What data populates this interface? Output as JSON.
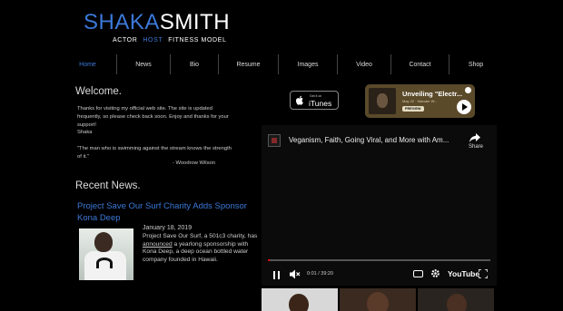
{
  "header": {
    "name_first": "SHAKA",
    "name_last": "SMITH",
    "tag1": "ACTOR",
    "tag2": "HOST",
    "tag3": "FITNESS MODEL"
  },
  "nav": {
    "items": [
      "Home",
      "News",
      "Bio",
      "Resume",
      "Images",
      "Video",
      "Contact",
      "Shop"
    ]
  },
  "welcome": {
    "title": "Welcome.",
    "body1": "Thanks for visiting my official web site. The site is updated frequently, so please check back soon. Enjoy and thanks for your support!",
    "body2": "Shaka",
    "quote": "\"The man who is swimming against the stream knows the strength of it.\"",
    "quote_author": "- Woodrow Wilson"
  },
  "news": {
    "title": "Recent News.",
    "headline": "Project Save Our Surf Charity Adds Sponsor Kona Deep",
    "date": "January 18, 2019",
    "body_pre": "Project Save Our Surf, a 501c3 charity, has ",
    "body_link": "announced",
    "body_post": " a yearlong sponsorship with Kona Deep, a deep ocean bottled water company founded in Hawaii."
  },
  "itunes": {
    "small": "Get it on",
    "big": "iTunes"
  },
  "spotify": {
    "title": "Unveiling \"Electr...",
    "meta": "May 22 · Wander W...",
    "preview": "PREVIEW"
  },
  "youtube": {
    "video_title": "Veganism, Faith, Going Viral, and More with Am...",
    "share_label": "Share",
    "time": "0:01 / 39:20",
    "logo": "YouTube",
    "progress": 0.01
  },
  "colors": {
    "accent": "#3b78d8",
    "background": "#000000"
  }
}
